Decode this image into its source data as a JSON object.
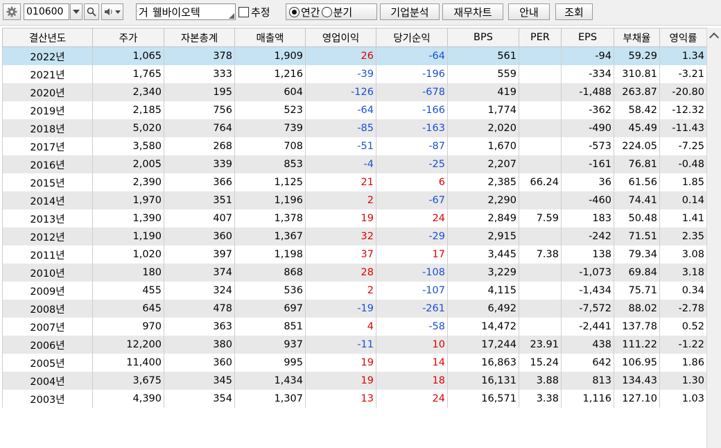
{
  "toolbar": {
    "code": "010600",
    "company_prefix": "거",
    "company_name": "웰바이오텍",
    "estimate_label": "추정",
    "annual_label": "연간",
    "quarter_label": "분기",
    "company_analysis": "기업분석",
    "financial_chart": "재무차트",
    "guide": "안내",
    "inquiry": "조회",
    "selected_period": "annual"
  },
  "table": {
    "headers": [
      "결산년도",
      "주가",
      "자본총계",
      "매출액",
      "영업이익",
      "당기순익",
      "BPS",
      "PER",
      "EPS",
      "부채율",
      "영익률"
    ],
    "rows": [
      [
        "2022년",
        "1,065",
        "378",
        "1,909",
        "26",
        "-64",
        "561",
        "",
        "-94",
        "59.29",
        "1.34"
      ],
      [
        "2021년",
        "1,765",
        "333",
        "1,216",
        "-39",
        "-196",
        "559",
        "",
        "-334",
        "310.81",
        "-3.21"
      ],
      [
        "2020년",
        "2,340",
        "195",
        "604",
        "-126",
        "-678",
        "419",
        "",
        "-1,488",
        "263.87",
        "-20.80"
      ],
      [
        "2019년",
        "2,185",
        "756",
        "523",
        "-64",
        "-166",
        "1,774",
        "",
        "-362",
        "58.42",
        "-12.32"
      ],
      [
        "2018년",
        "5,020",
        "764",
        "739",
        "-85",
        "-163",
        "2,020",
        "",
        "-490",
        "45.49",
        "-11.43"
      ],
      [
        "2017년",
        "3,580",
        "268",
        "708",
        "-51",
        "-87",
        "1,670",
        "",
        "-573",
        "224.05",
        "-7.25"
      ],
      [
        "2016년",
        "2,005",
        "339",
        "853",
        "-4",
        "-25",
        "2,207",
        "",
        "-161",
        "76.81",
        "-0.48"
      ],
      [
        "2015년",
        "2,390",
        "366",
        "1,125",
        "21",
        "6",
        "2,385",
        "66.24",
        "36",
        "61.56",
        "1.85"
      ],
      [
        "2014년",
        "1,970",
        "351",
        "1,196",
        "2",
        "-67",
        "2,290",
        "",
        "-460",
        "74.41",
        "0.14"
      ],
      [
        "2013년",
        "1,390",
        "407",
        "1,378",
        "19",
        "24",
        "2,849",
        "7.59",
        "183",
        "50.48",
        "1.41"
      ],
      [
        "2012년",
        "1,190",
        "360",
        "1,367",
        "32",
        "-29",
        "2,915",
        "",
        "-242",
        "71.51",
        "2.35"
      ],
      [
        "2011년",
        "1,020",
        "397",
        "1,198",
        "37",
        "17",
        "3,445",
        "7.38",
        "138",
        "79.34",
        "3.08"
      ],
      [
        "2010년",
        "180",
        "374",
        "868",
        "28",
        "-108",
        "3,229",
        "",
        "-1,073",
        "69.84",
        "3.18"
      ],
      [
        "2009년",
        "455",
        "324",
        "536",
        "2",
        "-107",
        "4,115",
        "",
        "-1,434",
        "75.71",
        "0.34"
      ],
      [
        "2008년",
        "645",
        "478",
        "697",
        "-19",
        "-261",
        "6,492",
        "",
        "-7,572",
        "88.02",
        "-2.78"
      ],
      [
        "2007년",
        "970",
        "363",
        "851",
        "4",
        "-58",
        "14,472",
        "",
        "-2,441",
        "137.78",
        "0.52"
      ],
      [
        "2006년",
        "12,200",
        "380",
        "937",
        "-11",
        "10",
        "17,244",
        "23.91",
        "438",
        "111.22",
        "-1.22"
      ],
      [
        "2005년",
        "11,400",
        "360",
        "995",
        "19",
        "14",
        "16,863",
        "15.24",
        "642",
        "106.95",
        "1.86"
      ],
      [
        "2004년",
        "3,675",
        "345",
        "1,434",
        "19",
        "18",
        "16,131",
        "3.88",
        "813",
        "134.43",
        "1.30"
      ],
      [
        "2003년",
        "4,390",
        "354",
        "1,307",
        "13",
        "24",
        "16,571",
        "3.38",
        "1,116",
        "127.10",
        "1.03"
      ]
    ]
  },
  "colors": {
    "positive": "#e00000",
    "negative": "#1a4fd8",
    "selected_row": "#c6e3f3",
    "alt_row": "#e8e8e8"
  }
}
